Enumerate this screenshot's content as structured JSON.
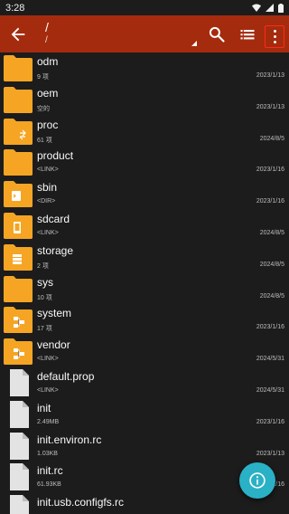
{
  "status_bar": {
    "time": "3:28"
  },
  "toolbar": {
    "path_primary": "/",
    "path_secondary": "/"
  },
  "files": [
    {
      "name": "odm",
      "meta": "9 项",
      "date": "2023/1/13",
      "type": "folder"
    },
    {
      "name": "oem",
      "meta": "空的",
      "date": "2023/1/13",
      "type": "folder"
    },
    {
      "name": "proc",
      "meta": "61 项",
      "date": "2024/8/5",
      "type": "folder-link"
    },
    {
      "name": "product",
      "meta": "<LINK>",
      "date": "2023/1/16",
      "type": "folder"
    },
    {
      "name": "sbin",
      "meta": "<DIR>",
      "date": "2023/1/16",
      "type": "folder-terminal"
    },
    {
      "name": "sdcard",
      "meta": "<LINK>",
      "date": "2024/8/5",
      "type": "folder-phone"
    },
    {
      "name": "storage",
      "meta": "2 项",
      "date": "2024/8/5",
      "type": "folder-storage"
    },
    {
      "name": "sys",
      "meta": "10 项",
      "date": "2024/8/5",
      "type": "folder"
    },
    {
      "name": "system",
      "meta": "17 项",
      "date": "2023/1/16",
      "type": "folder-network"
    },
    {
      "name": "vendor",
      "meta": "<LINK>",
      "date": "2024/5/31",
      "type": "folder-network"
    },
    {
      "name": "default.prop",
      "meta": "<LINK>",
      "date": "2024/5/31",
      "type": "file"
    },
    {
      "name": "init",
      "meta": "2.49MB",
      "date": "2023/1/16",
      "type": "file"
    },
    {
      "name": "init.environ.rc",
      "meta": "1.03KB",
      "date": "2023/1/13",
      "type": "file"
    },
    {
      "name": "init.rc",
      "meta": "61.93KB",
      "date": "2023/1/16",
      "type": "file"
    },
    {
      "name": "init.usb.configfs.rc",
      "meta": "",
      "date": "",
      "type": "file"
    }
  ],
  "colors": {
    "toolbar": "#a52b0e",
    "folder": "#f5a524",
    "fab": "#2ab1c5",
    "highlight": "#ff2a1a"
  },
  "icons": {
    "back": "arrow-left-icon",
    "search": "search-icon",
    "list_view": "list-view-icon",
    "more": "more-vertical-icon",
    "fab": "info-icon"
  }
}
